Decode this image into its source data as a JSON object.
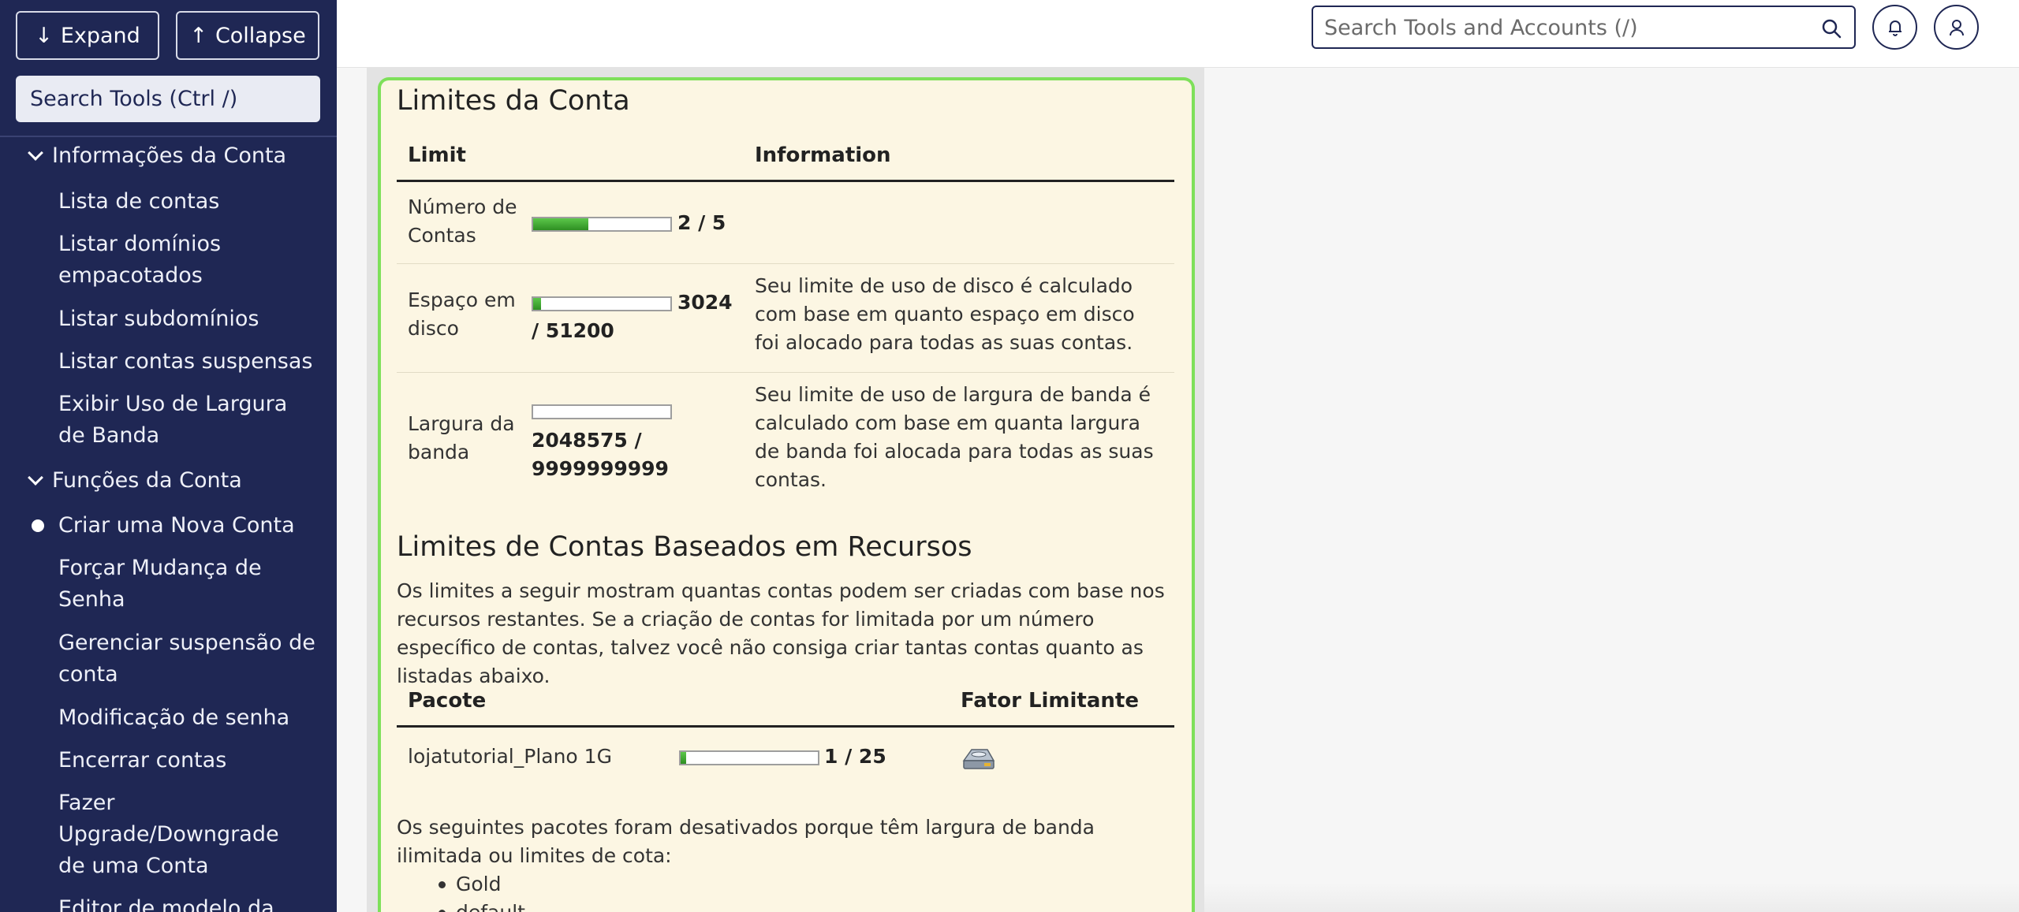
{
  "sidebar": {
    "expand_label": "Expand",
    "collapse_label": "Collapse",
    "search_label": "Search Tools (Ctrl /)",
    "groups": [
      {
        "label": "Informações da Conta",
        "items": [
          {
            "label": "Lista de contas"
          },
          {
            "label": "Listar domínios empacotados"
          },
          {
            "label": "Listar subdomínios"
          },
          {
            "label": "Listar contas suspensas"
          },
          {
            "label": "Exibir Uso de Largura de Banda"
          }
        ]
      },
      {
        "label": "Funções da Conta",
        "items": [
          {
            "label": "Criar uma Nova Conta",
            "active": true
          },
          {
            "label": "Forçar Mudança de Senha"
          },
          {
            "label": "Gerenciar suspensão de conta"
          },
          {
            "label": "Modificação de senha"
          },
          {
            "label": "Encerrar contas"
          },
          {
            "label": "Fazer Upgrade/Downgrade de uma Conta"
          },
          {
            "label": "Editor de modelo da"
          }
        ]
      }
    ]
  },
  "topbar": {
    "search_placeholder": "Search Tools and Accounts (/)",
    "icons": [
      "search-icon",
      "bell-icon",
      "user-icon"
    ]
  },
  "limits": {
    "title": "Limites da Conta",
    "col_limit": "Limit",
    "col_info": "Information",
    "rows": [
      {
        "label": "Número de Contas",
        "value": "2 / 5",
        "used": 2,
        "max": 5,
        "info": ""
      },
      {
        "label": "Espaço em disco",
        "value": "3024 / 51200",
        "used": 3024,
        "max": 51200,
        "info": "Seu limite de uso de disco é calculado com base em quanto espaço em disco foi alocado para todas as suas contas."
      },
      {
        "label": "Largura da banda",
        "value": "2048575 / 9999999999",
        "used": 2048575,
        "max": 9999999999,
        "info": "Seu limite de uso de largura de banda é calculado com base em quanta largura de banda foi alocada para todas as suas contas."
      }
    ]
  },
  "resources": {
    "title": "Limites de Contas Baseados em Recursos",
    "description": "Os limites a seguir mostram quantas contas podem ser criadas com base nos recursos restantes. Se a criação de contas for limitada por um número específico de contas, talvez você não consiga criar tantas contas quanto as listadas abaixo.",
    "col_package": "Pacote",
    "col_factor": "Fator Limitante",
    "rows": [
      {
        "package": "lojatutorial_Plano 1G",
        "value": "1 / 25",
        "used": 1,
        "max": 25,
        "factor_icon": "disk-icon"
      }
    ],
    "disabled_note": "Os seguintes pacotes foram desativados porque têm largura de banda ilimitada ou limites de cota:",
    "disabled_packages": [
      "Gold",
      "default"
    ]
  },
  "colors": {
    "sidebar_bg": "#1f2754",
    "panel_bg": "#fcf6e3",
    "panel_border": "#7ee05a",
    "bar_fill": "#3aa52c"
  }
}
